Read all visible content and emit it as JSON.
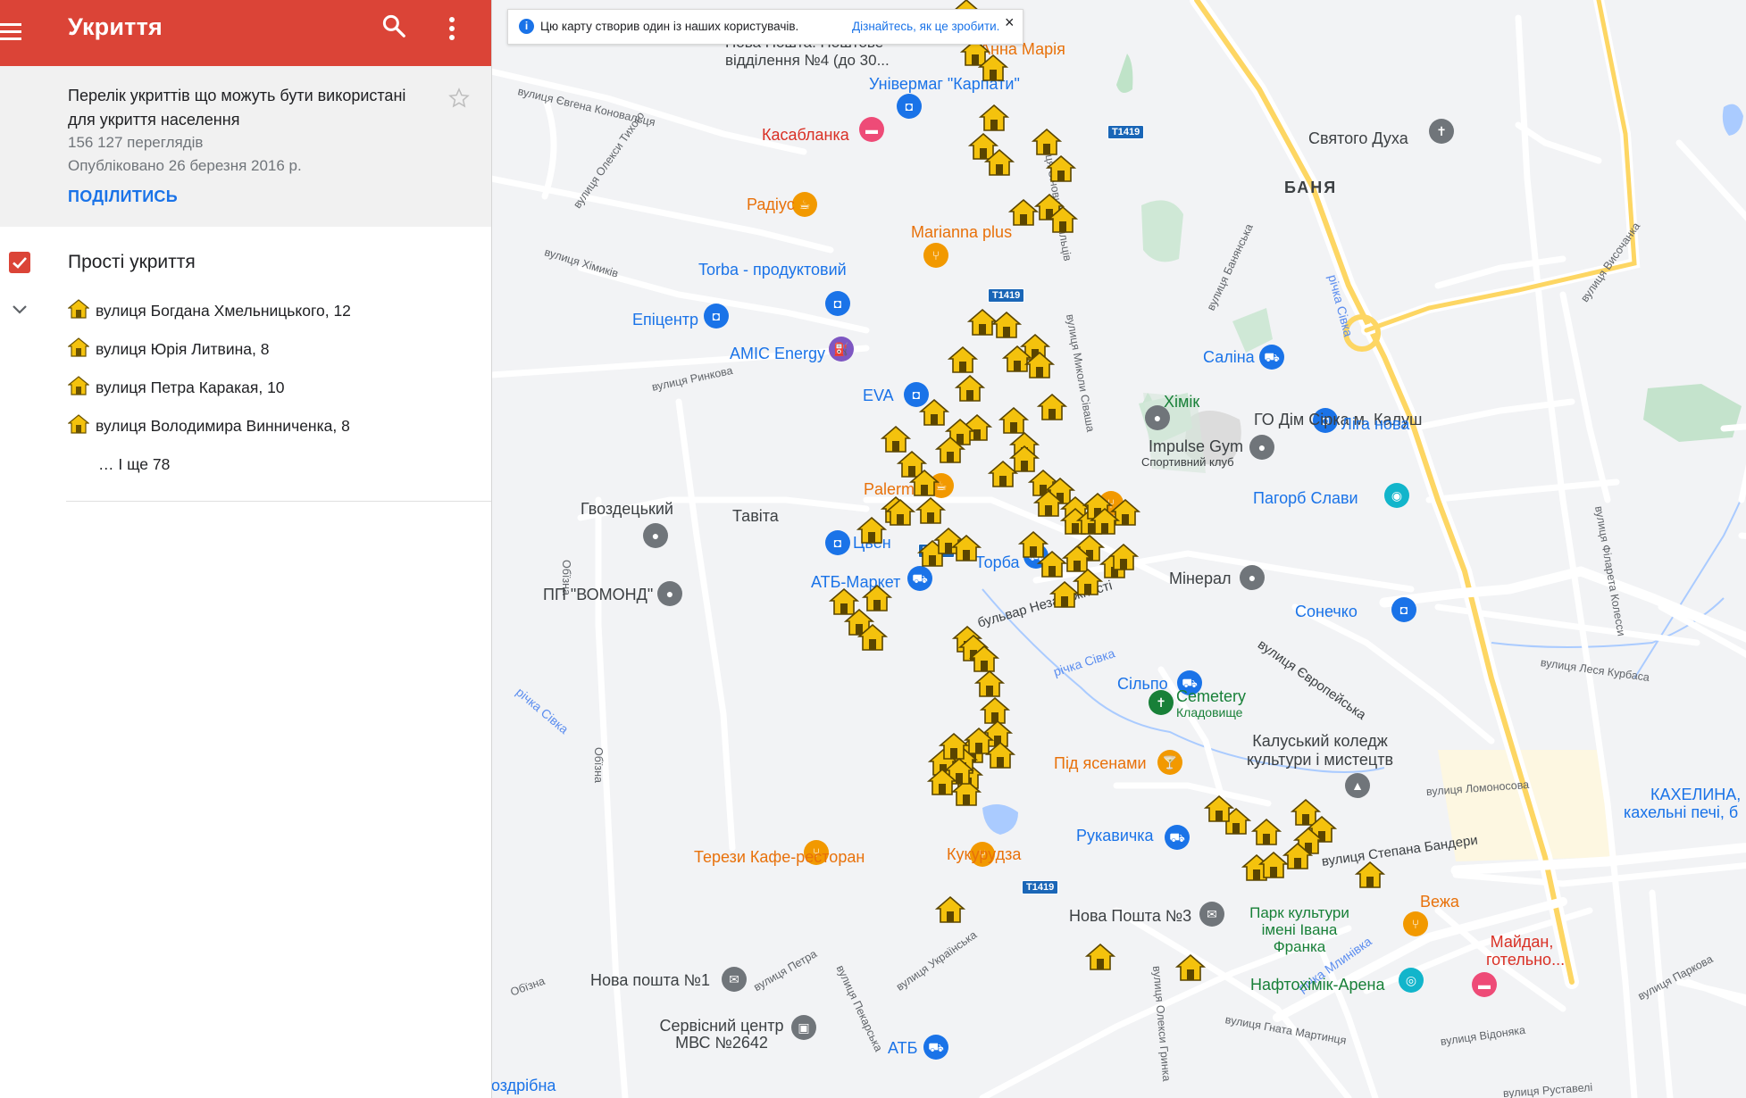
{
  "app_bar": {
    "title": "Укриття",
    "color": "#db4437"
  },
  "map_info": {
    "description": "Перелік укриттів що можуть бути використані для укриття населення",
    "views": "156 127 переглядів",
    "published": "Опубліковано 26 березня 2016 р.",
    "share_label": "ПОДІЛИТИСЬ"
  },
  "layer": {
    "title": "Прості укриття",
    "checked": true,
    "items": [
      {
        "label": "вулиця Богдана Хмельницького, 12"
      },
      {
        "label": "вулиця Юрія Литвина, 8"
      },
      {
        "label": "вулиця Петра Каракая, 10"
      },
      {
        "label": "вулиця Володимира Винниченка, 8"
      }
    ],
    "more_label": "… І ще 78"
  },
  "notice": {
    "text": "Цю карту створив один із наших користувачів.",
    "link": "Дізнайтесь, як це зробити."
  },
  "map": {
    "road_badges": [
      "T1419",
      "T1419",
      "T1419",
      "T1419"
    ],
    "districts": [
      "БАНЯ"
    ],
    "pois": {
      "anna_maria": "Анна Марія",
      "nova_poshta_4": "Нова Пошта. Поштове відділення №4 (до 30...",
      "univermag": "Універмаг \"Карпати\"",
      "kasablanka": "Касабланка",
      "radius": "Радіус",
      "marianna": "Marianna plus",
      "torba_prod": "Torba - продуктовий",
      "epicentr": "Епіцентр",
      "amic": "AMIC Energy",
      "eva": "EVA",
      "palermo": "Palermo",
      "gvozdetskyi": "Гвоздецький",
      "tavita": "Тавіта",
      "tsien": "Цьен",
      "atb_market": "АТБ-Маркет",
      "torba": "Торба",
      "vomond": "ПП \"ВОМОНД\"",
      "svyatoho_dukha": "Святого Духа",
      "salina": "Саліна",
      "khimik": "Хімік",
      "dim_sirka": "ГО Дім Сірка м. Калуш",
      "liha_nova": "Ліга нова",
      "impulse_gym": "Impulse Gym",
      "impulse_sub": "Спортивний клуб",
      "pahorb_slavy": "Пагорб Слави",
      "mineral": "Мінерал",
      "sonechko": "Сонечко",
      "silpo": "Сільпо",
      "cemetery": "Cemetery",
      "cemetery_sub": "Кладовище",
      "pid_yasenamy": "Під ясенами",
      "koledzh": "Калуський коледж культури і мистецтв",
      "kakhelyna": "КАХЕЛИНА,",
      "kakhelyna_sub": "кахельні печі, б",
      "rukavychka": "Рукавичка",
      "kukurudza": "Кукурудза",
      "terezy": "Терези Кафе-ресторан",
      "nova_poshta_3": "Нова Пошта №3",
      "vezha": "Вежа",
      "park": "Парк культури імені Івана Франка",
      "maidan": "Майдан, готельно...",
      "naftokhimik": "Нафтохімік-Арена",
      "nova_poshta_1": "Нова пошта №1",
      "servisnyi": "Сервісний центр МВС №2642",
      "atb": "АТБ",
      "dribna": "оздрібна"
    },
    "streets": {
      "konovaltsya": "вулиця Євгена Коновальця",
      "tykhoho": "вулиця Олекси Тихого",
      "khimikiv": "вулиця Хімиків",
      "sichovykh": "вулиця Січових Стрільців",
      "sivasha": "вулиця Миколи Сівашa",
      "rynkova": "вулиця Ринкова",
      "bulvar": "бульвар Незалежності",
      "yevropeiska": "вулиця Європейська",
      "lomonosova": "вулиця Ломоносова",
      "bandery": "вулиця Степана Бандери",
      "kurbasa": "вулиця Леся Курбаса",
      "filareta": "вулиця Філарета Колесси",
      "vysochanka": "вулиця Височанка",
      "banyanska": "вулиця Банянська",
      "obiizna1": "Обїзна",
      "obiizna2": "Обїзна",
      "obiizna3": "Обїзна",
      "sivka1": "річка Сівка",
      "sivka2": "річка Сівка",
      "sivka3": "річка Сівка",
      "mlynivka": "річка Млинівка",
      "petra": "вулиця Петра",
      "pekarska": "вулиця Пекарська",
      "ukrainska": "вулиця Українська",
      "hrynka": "вулиця Олекси Гринка",
      "martynca": "вулиця Гната Мартинця",
      "vidonyaka": "вулиця Відоняка",
      "parkova": "вулиця Паркова",
      "rustaveli": "вулиця Руставелі"
    }
  }
}
